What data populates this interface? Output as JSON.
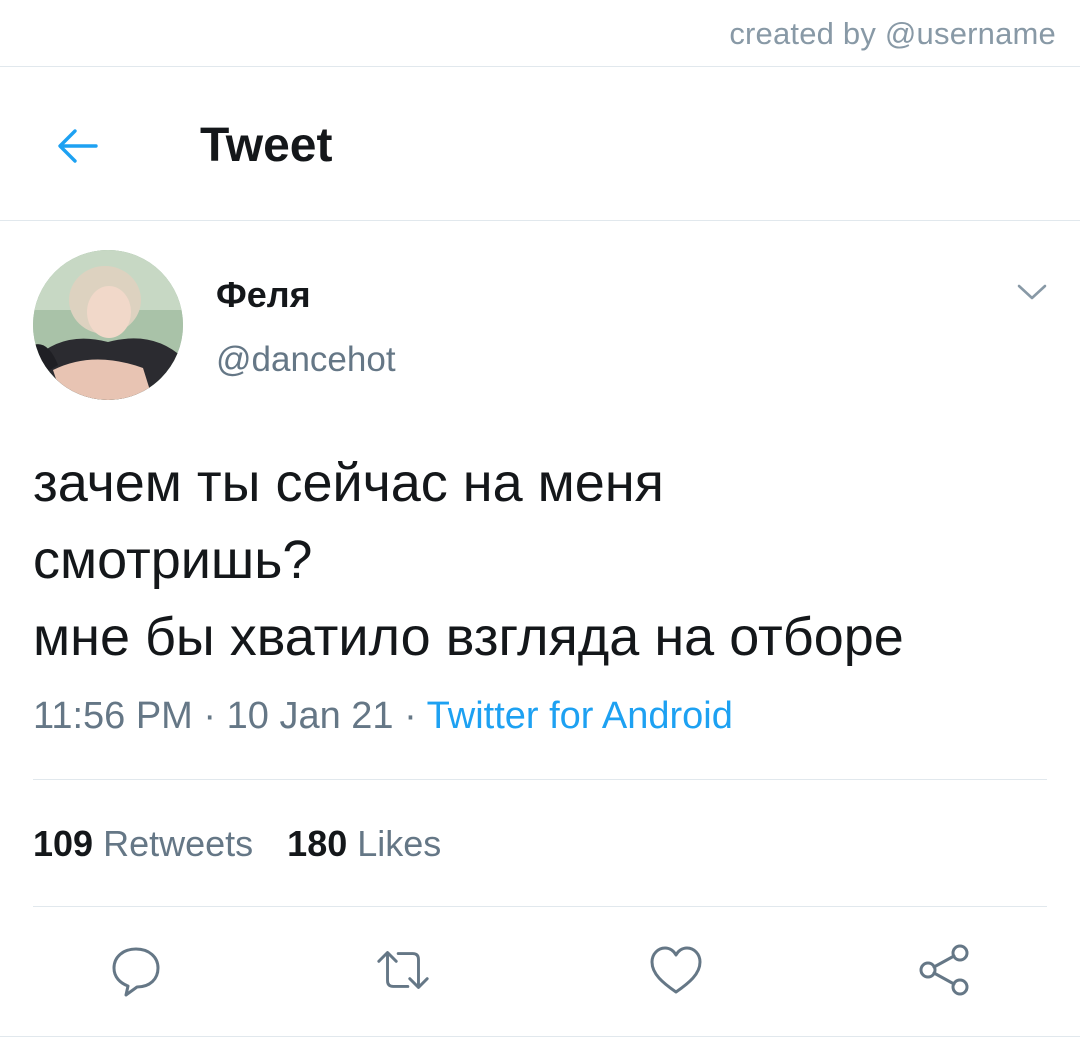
{
  "watermark": {
    "text": "created by @username"
  },
  "header": {
    "title": "Tweet",
    "back_icon": "arrow-left-icon"
  },
  "author": {
    "display_name": "Феля",
    "handle": "@dancehot"
  },
  "tweet": {
    "lines": [
      "зачем ты сейчас на меня",
      "смотришь?",
      "мне бы хватило взгляда на отборе"
    ],
    "time": "11:56 PM",
    "date": "10 Jan 21",
    "separator": " · ",
    "source": "Twitter for Android"
  },
  "stats": {
    "retweets_count": "109",
    "retweets_label": "Retweets",
    "likes_count": "180",
    "likes_label": "Likes"
  },
  "actions": [
    "reply-icon",
    "retweet-icon",
    "like-icon",
    "share-icon"
  ],
  "colors": {
    "accent": "#1da1f2",
    "text_primary": "#14171a",
    "text_secondary": "#657786",
    "divider": "#e1e8ed"
  }
}
